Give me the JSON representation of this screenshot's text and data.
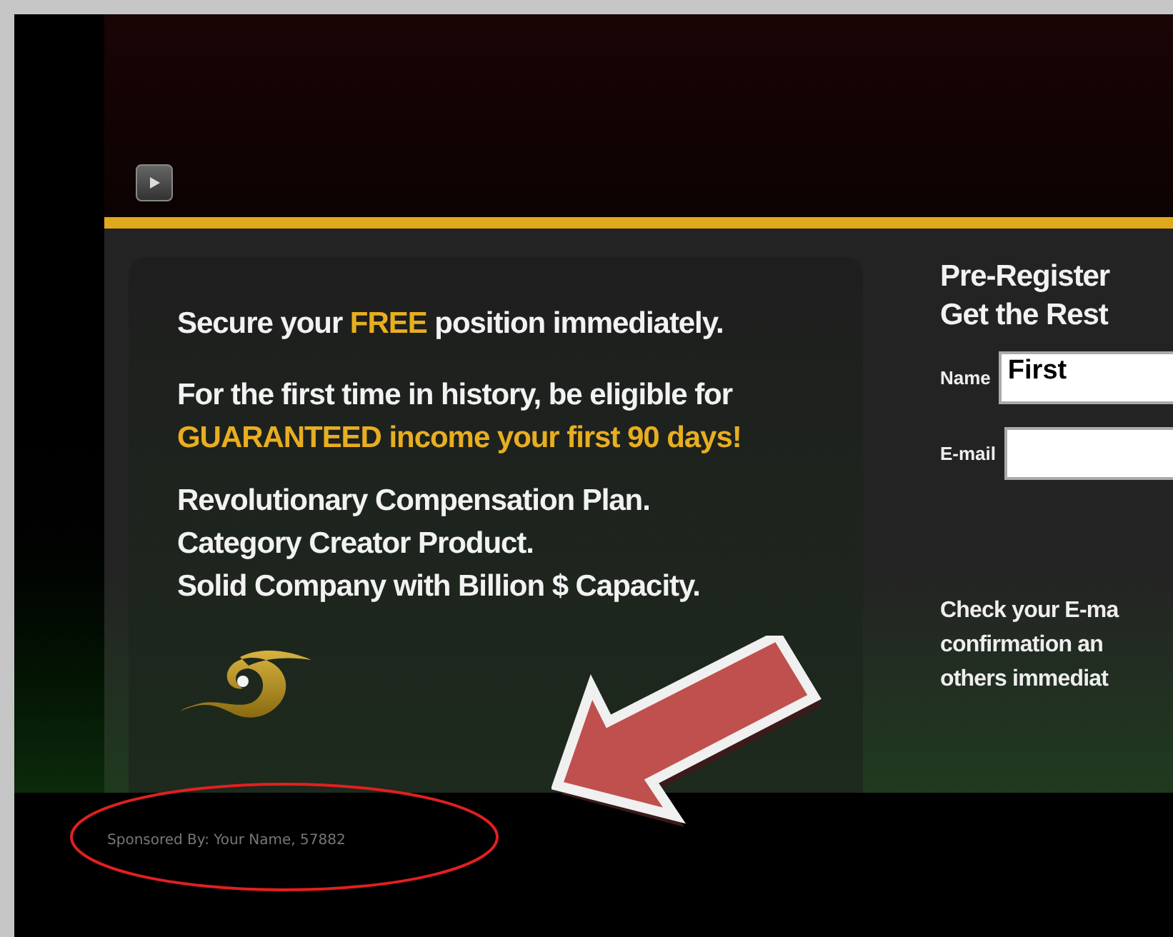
{
  "card": {
    "paragraphs": [
      {
        "kind": "headline",
        "parts": [
          {
            "text": "Secure your ",
            "highlight": false
          },
          {
            "text": "FREE",
            "highlight": true
          },
          {
            "text": " position immediately.",
            "highlight": false
          }
        ]
      },
      {
        "kind": "headline",
        "parts": [
          {
            "text": "For the first time in history, be eligible for ",
            "highlight": false
          },
          {
            "text": "GUARANTEED income your first 90 days!",
            "highlight": true
          }
        ]
      },
      {
        "kind": "list",
        "lines": [
          "Revolutionary Compensation Plan.",
          "Category Creator Product.",
          "Solid Company with Billion $ Capacity."
        ]
      }
    ]
  },
  "form": {
    "title_lines": [
      "Pre-Register",
      "Get the Rest"
    ],
    "fields": [
      {
        "label": "Name",
        "value": "First"
      },
      {
        "label": "E-mail"
      }
    ],
    "note_lines": [
      "Check your E-ma",
      "confirmation an",
      "others immediat"
    ]
  },
  "footer": {
    "sponsor": "Sponsored By: Your Name, 57882"
  }
}
